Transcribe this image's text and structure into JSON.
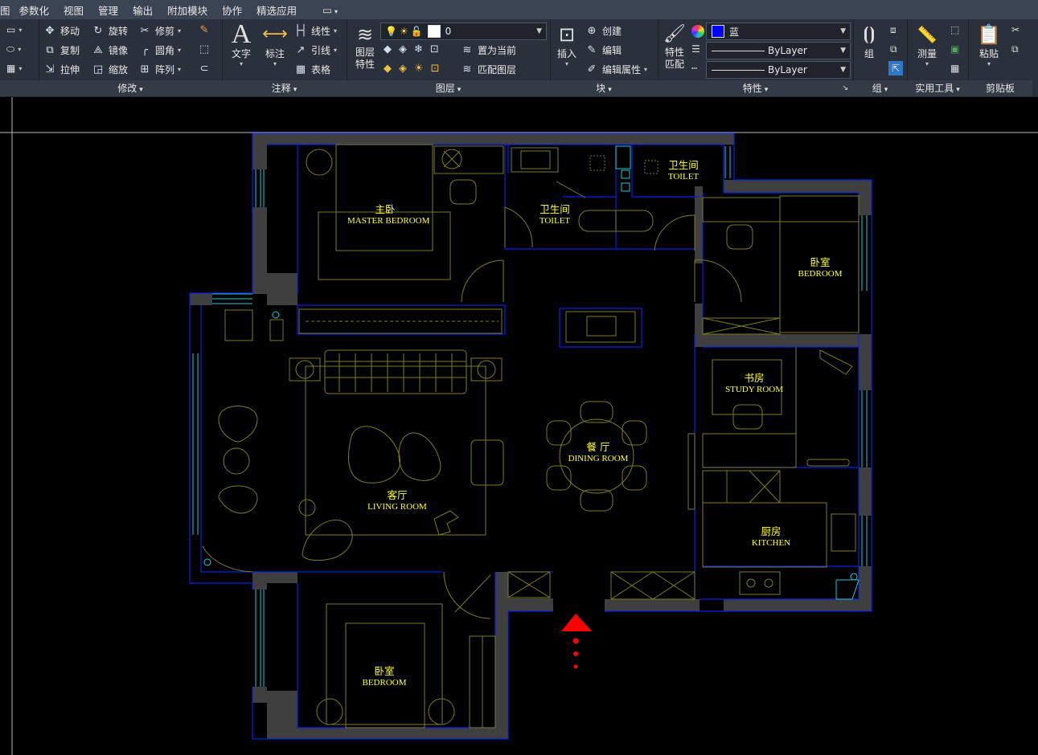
{
  "menu": [
    "参数化",
    "视图",
    "管理",
    "输出",
    "附加模块",
    "协作",
    "精选应用"
  ],
  "menu_prefix": "图",
  "panels": {
    "modify": {
      "title": "修改",
      "move": "移动",
      "rotate": "旋转",
      "trim": "修剪",
      "copy": "复制",
      "mirror": "镜像",
      "fillet": "圆角",
      "stretch": "拉伸",
      "scale": "缩放",
      "array": "阵列"
    },
    "annotation": {
      "title": "注释",
      "text": "文字",
      "dimension": "标注",
      "linear": "线性",
      "leader": "引线",
      "table": "表格"
    },
    "layers": {
      "title": "图层",
      "layer_props_line1": "图层",
      "layer_props_line2": "特性",
      "layer_value": "0",
      "set_current": "置为当前",
      "match_layer": "匹配图层"
    },
    "block": {
      "title": "块",
      "insert": "插入",
      "create": "创建",
      "edit": "编辑",
      "edit_attributes": "编辑属性"
    },
    "properties": {
      "title": "特性",
      "match_line1": "特性",
      "match_line2": "匹配",
      "color_value": "蓝",
      "linetype_value": "ByLayer",
      "lineweight_value": "ByLayer",
      "color_hex": "#0000ff"
    },
    "groups": {
      "title": "组",
      "group": "组"
    },
    "utilities": {
      "title": "实用工具",
      "measure": "测量"
    },
    "clipboard": {
      "title": "剪贴板",
      "paste": "粘贴"
    }
  },
  "rooms": {
    "master_bedroom": {
      "cn": "主卧",
      "en": "MASTER BEDROOM"
    },
    "toilet_1": {
      "cn": "卫生间",
      "en": "TOILET"
    },
    "toilet_2": {
      "cn": "卫生间",
      "en": "TOILET"
    },
    "bedroom_1": {
      "cn": "卧室",
      "en": "BEDROOM"
    },
    "study": {
      "cn": "书房",
      "en": "STUDY ROOM"
    },
    "dining": {
      "cn": "餐 厅",
      "en": "DINING ROOM"
    },
    "living": {
      "cn": "客厅",
      "en": "LIVING ROOM"
    },
    "kitchen": {
      "cn": "厨房",
      "en": "KITCHEN"
    },
    "bedroom_2": {
      "cn": "卧室",
      "en": "BEDROOM"
    }
  },
  "colors": {
    "wall": "#3f3f3f",
    "wall_line": "#0a20e6",
    "window": "#27c6d6",
    "furniture": "#7d7d1c",
    "label": "#ffff33",
    "entry_marker": "#ff0000"
  }
}
